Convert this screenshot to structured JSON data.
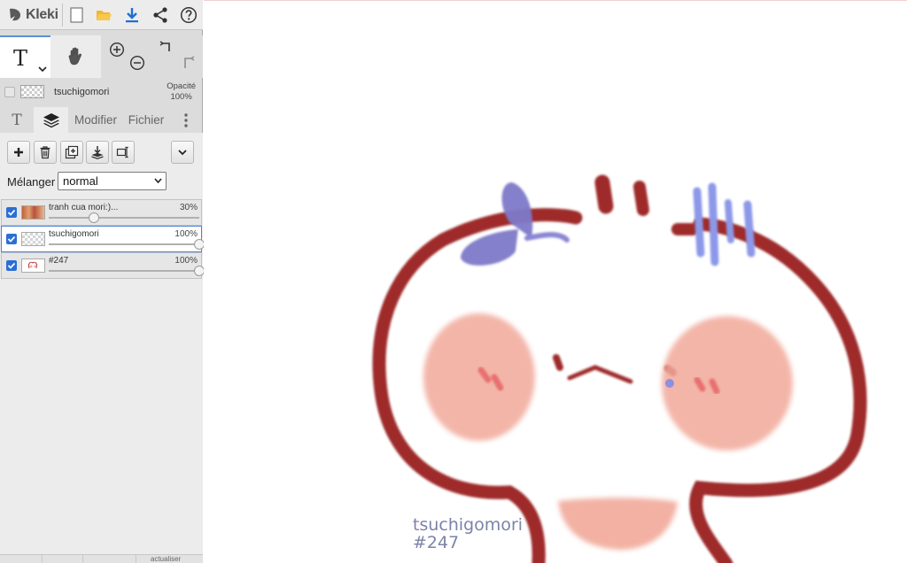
{
  "app": {
    "name": "Kleki"
  },
  "tools": {
    "text_glyph": "T"
  },
  "active_layer": {
    "name": "tsuchigomori",
    "opacity_label": "Opacité",
    "opacity_value": "100%"
  },
  "tabs": {
    "text_glyph": "T",
    "modify_label": "Modifier",
    "file_label": "Fichier"
  },
  "layers_panel": {
    "blend_label": "Mélanger",
    "blend_value": "normal",
    "layers": [
      {
        "name": "tranh cua mori:)...",
        "opacity": "30%",
        "opacity_value": 0.3,
        "selected": false
      },
      {
        "name": "tsuchigomori",
        "opacity": "100%",
        "opacity_value": 1.0,
        "selected": true
      },
      {
        "name": "#247",
        "opacity": "100%",
        "opacity_value": 1.0,
        "selected": false
      }
    ]
  },
  "bottom_bar": {
    "partial_text": "actualiser"
  },
  "canvas": {
    "signature_name": "tsuchigomori",
    "signature_number": "#247"
  },
  "icons": [
    "kleki-logo-icon",
    "new-file-icon",
    "open-folder-icon",
    "download-icon",
    "share-icon",
    "help-icon",
    "chevron-down-icon",
    "hand-icon",
    "zoom-in-icon",
    "zoom-out-icon",
    "undo-icon",
    "redo-icon",
    "layers-icon",
    "more-vertical-icon",
    "plus-icon",
    "trash-icon",
    "duplicate-icon",
    "merge-down-icon",
    "rename-icon",
    "checkbox-icon"
  ],
  "colors": {
    "accent": "#2b6fd6",
    "stroke": "#9e2a2a",
    "cheek": "#f1a99a",
    "bow": "#7d78c8",
    "signature": "#7b84a8"
  }
}
